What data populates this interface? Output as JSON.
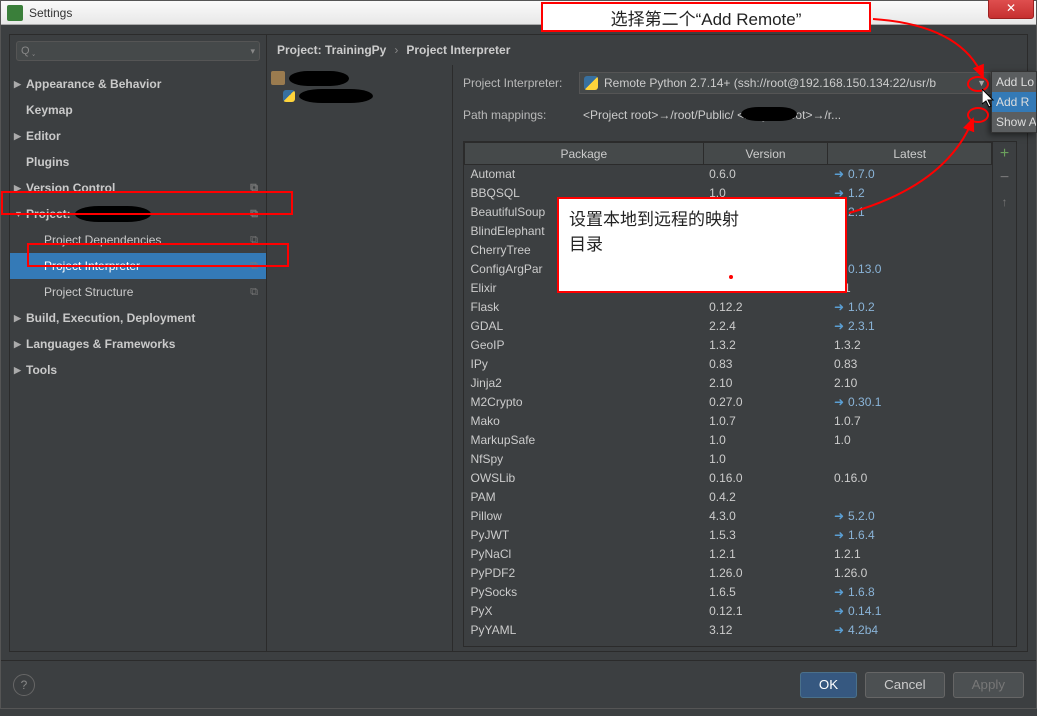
{
  "window": {
    "title": "Settings"
  },
  "sidebar": {
    "search_placeholder": "",
    "items": [
      {
        "label": "Appearance & Behavior",
        "bold": true,
        "arrow": "▶"
      },
      {
        "label": "Keymap",
        "bold": true
      },
      {
        "label": "Editor",
        "bold": true,
        "arrow": "▶"
      },
      {
        "label": "Plugins",
        "bold": true
      },
      {
        "label": "Version Control",
        "bold": true,
        "arrow": "▶",
        "mod": "⧉"
      },
      {
        "label": "Project:",
        "bold": true,
        "arrow": "▼",
        "mod": "⧉",
        "redacted": true
      },
      {
        "label": "Project Dependencies",
        "lvl": 1,
        "mod": "⧉"
      },
      {
        "label": "Project Interpreter",
        "lvl": 1,
        "mod": "⧉",
        "selected": true
      },
      {
        "label": "Project Structure",
        "lvl": 1,
        "mod": "⧉"
      },
      {
        "label": "Build, Execution, Deployment",
        "bold": true,
        "arrow": "▶"
      },
      {
        "label": "Languages & Frameworks",
        "bold": true,
        "arrow": "▶"
      },
      {
        "label": "Tools",
        "bold": true,
        "arrow": "▶"
      }
    ]
  },
  "breadcrumb": {
    "a": "Project: TrainingPy",
    "b": "Project Interpreter"
  },
  "interpreter": {
    "label": "Project Interpreter:",
    "value": "Remote Python 2.7.14+ (ssh://root@192.168.150.134:22/usr/b"
  },
  "pathmap": {
    "label": "Path mappings:",
    "value": "<Project root>→/root/Public/             <Project root>→/r...",
    "more": "..."
  },
  "menu": {
    "add_local": "Add Lo",
    "add_remote": "Add R",
    "show_all": "Show A"
  },
  "table": {
    "headers": [
      "Package",
      "Version",
      "Latest"
    ],
    "rows": [
      {
        "p": "Automat",
        "v": "0.6.0",
        "l": "0.7.0",
        "up": true
      },
      {
        "p": "BBQSQL",
        "v": "1.0",
        "l": "1.2",
        "up": true
      },
      {
        "p": "BeautifulSoup",
        "v": "",
        "l": "2.1",
        "up": true
      },
      {
        "p": "BlindElephant",
        "v": "",
        "l": ""
      },
      {
        "p": "CherryTree",
        "v": "",
        "l": ""
      },
      {
        "p": "ConfigArgPar",
        "v": "",
        "l": "0.13.0",
        "up": true
      },
      {
        "p": "Elixir",
        "v": "",
        "l": "7.1"
      },
      {
        "p": "Flask",
        "v": "0.12.2",
        "l": "1.0.2",
        "up": true
      },
      {
        "p": "GDAL",
        "v": "2.2.4",
        "l": "2.3.1",
        "up": true
      },
      {
        "p": "GeoIP",
        "v": "1.3.2",
        "l": "1.3.2"
      },
      {
        "p": "IPy",
        "v": "0.83",
        "l": "0.83"
      },
      {
        "p": "Jinja2",
        "v": "2.10",
        "l": "2.10"
      },
      {
        "p": "M2Crypto",
        "v": "0.27.0",
        "l": "0.30.1",
        "up": true
      },
      {
        "p": "Mako",
        "v": "1.0.7",
        "l": "1.0.7"
      },
      {
        "p": "MarkupSafe",
        "v": "1.0",
        "l": "1.0"
      },
      {
        "p": "NfSpy",
        "v": "1.0",
        "l": ""
      },
      {
        "p": "OWSLib",
        "v": "0.16.0",
        "l": "0.16.0"
      },
      {
        "p": "PAM",
        "v": "0.4.2",
        "l": ""
      },
      {
        "p": "Pillow",
        "v": "4.3.0",
        "l": "5.2.0",
        "up": true
      },
      {
        "p": "PyJWT",
        "v": "1.5.3",
        "l": "1.6.4",
        "up": true
      },
      {
        "p": "PyNaCl",
        "v": "1.2.1",
        "l": "1.2.1"
      },
      {
        "p": "PyPDF2",
        "v": "1.26.0",
        "l": "1.26.0"
      },
      {
        "p": "PySocks",
        "v": "1.6.5",
        "l": "1.6.8",
        "up": true
      },
      {
        "p": "PyX",
        "v": "0.12.1",
        "l": "0.14.1",
        "up": true
      },
      {
        "p": "PyYAML",
        "v": "3.12",
        "l": "4.2b4",
        "up": true
      }
    ]
  },
  "footer": {
    "ok": "OK",
    "cancel": "Cancel",
    "apply": "Apply"
  },
  "annotations": {
    "a1": "选择第二个“Add  Remote”",
    "a2_line1": "设置本地到远程的映射",
    "a2_line2": "目录"
  }
}
